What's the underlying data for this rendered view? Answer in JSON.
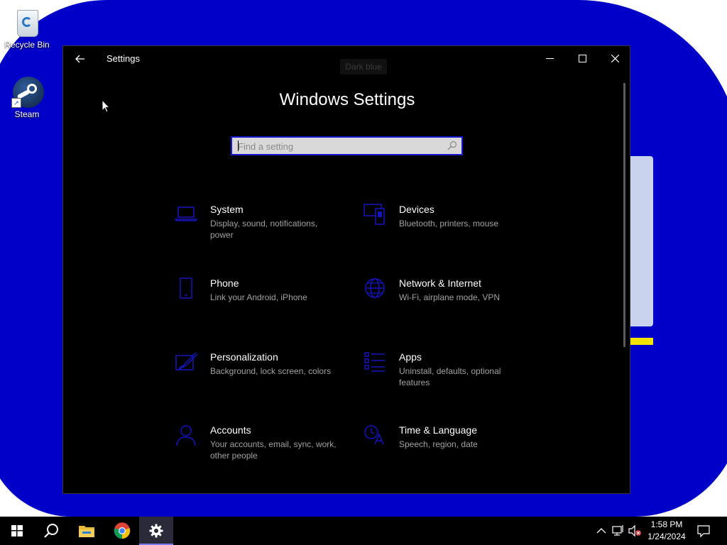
{
  "desktop": {
    "icons": [
      {
        "label": "Recycle Bin",
        "icon": "recycle-bin-icon"
      },
      {
        "label": "Steam",
        "icon": "steam-icon"
      }
    ]
  },
  "window": {
    "title": "Settings",
    "ghost_label": "Dark blue",
    "heading": "Windows Settings",
    "search": {
      "placeholder": "Find a setting",
      "value": ""
    },
    "categories": [
      {
        "title": "System",
        "description": "Display, sound, notifications, power",
        "icon": "laptop-icon"
      },
      {
        "title": "Devices",
        "description": "Bluetooth, printers, mouse",
        "icon": "devices-icon"
      },
      {
        "title": "Phone",
        "description": "Link your Android, iPhone",
        "icon": "phone-icon"
      },
      {
        "title": "Network & Internet",
        "description": "Wi-Fi, airplane mode, VPN",
        "icon": "globe-icon"
      },
      {
        "title": "Personalization",
        "description": "Background, lock screen, colors",
        "icon": "paint-icon"
      },
      {
        "title": "Apps",
        "description": "Uninstall, defaults, optional features",
        "icon": "apps-list-icon"
      },
      {
        "title": "Accounts",
        "description": "Your accounts, email, sync, work, other people",
        "icon": "person-icon"
      },
      {
        "title": "Time & Language",
        "description": "Speech, region, date",
        "icon": "time-language-icon"
      }
    ]
  },
  "taskbar": {
    "apps": [
      "start-icon",
      "search-icon",
      "file-explorer-icon",
      "chrome-icon",
      "settings-gear-icon"
    ],
    "clock": {
      "time": "1:58 PM",
      "date": "1/24/2024"
    }
  },
  "colors": {
    "accent": "#1818d0",
    "wallpaper": "#0000c8",
    "window_bg": "#000000"
  }
}
